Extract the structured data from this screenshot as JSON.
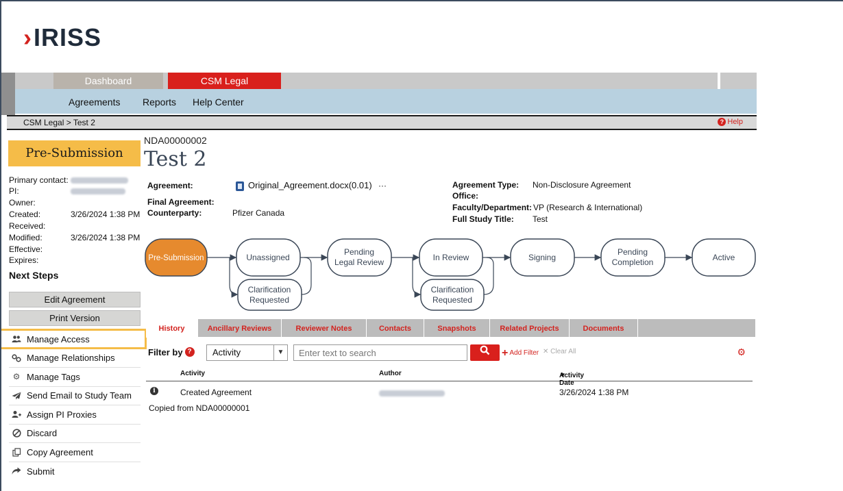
{
  "logo": {
    "chevron": "›",
    "text": "IRISS"
  },
  "top_nav": {
    "tabs": [
      {
        "label": "Dashboard",
        "active": false
      },
      {
        "label": "CSM Legal",
        "active": true
      }
    ]
  },
  "sub_nav": {
    "items": [
      "Agreements",
      "Reports",
      "Help Center"
    ]
  },
  "breadcrumb": {
    "root": "CSM Legal",
    "separator": ">",
    "current": "Test 2",
    "help_label": "Help"
  },
  "status": {
    "label": "Pre-Submission"
  },
  "details": {
    "primary_contact_label": "Primary contact:",
    "pi_label": "PI:",
    "owner_label": "Owner:",
    "created_label": "Created:",
    "created_value": "3/26/2024 1:38 PM",
    "received_label": "Received:",
    "modified_label": "Modified:",
    "modified_value": "3/26/2024 1:38 PM",
    "effective_label": "Effective:",
    "expires_label": "Expires:"
  },
  "next_steps": {
    "heading": "Next Steps",
    "edit_label": "Edit Agreement",
    "print_label": "Print Version",
    "actions": [
      {
        "label": "Manage Access",
        "icon": "users-icon"
      },
      {
        "label": "Manage Relationships",
        "icon": "link-icon"
      },
      {
        "label": "Manage Tags",
        "icon": "gear-icon"
      },
      {
        "label": "Send Email to Study Team",
        "icon": "paper-plane-icon"
      },
      {
        "label": "Assign PI Proxies",
        "icon": "user-plus-icon"
      },
      {
        "label": "Discard",
        "icon": "ban-icon"
      },
      {
        "label": "Copy Agreement",
        "icon": "copy-icon"
      },
      {
        "label": "Submit",
        "icon": "share-arrow-icon"
      }
    ]
  },
  "record": {
    "id": "NDA00000002",
    "title": "Test 2",
    "agreement_label": "Agreement:",
    "agreement_file": "Original_Agreement.docx(0.01)",
    "more": "···",
    "final_agreement_label": "Final Agreement:",
    "counterparty_label": "Counterparty:",
    "counterparty_value": "Pfizer Canada",
    "agreement_type_label": "Agreement Type:",
    "agreement_type_value": "Non-Disclosure Agreement",
    "office_label": "Office:",
    "faculty_label": "Faculty/Department:",
    "faculty_value": "VP (Research & International)",
    "full_title_label": "Full Study Title:",
    "full_title_value": "Test"
  },
  "workflow": {
    "states": [
      {
        "label": "Pre-Submission",
        "current": true
      },
      {
        "label": "Unassigned"
      },
      {
        "label": "Pending Legal Review"
      },
      {
        "label": "In Review"
      },
      {
        "label": "Signing"
      },
      {
        "label": "Pending Completion"
      },
      {
        "label": "Active"
      }
    ],
    "clarification_label": "Clarification Requested",
    "colors": {
      "current": "#e68a2e",
      "border": "#3a4656"
    }
  },
  "tabs": {
    "items": [
      "History",
      "Ancillary Reviews",
      "Reviewer Notes",
      "Contacts",
      "Snapshots",
      "Related Projects",
      "Documents"
    ],
    "active": "History"
  },
  "filter": {
    "label": "Filter by",
    "select_value": "Activity",
    "search_placeholder": "Enter text to search",
    "add_filter": "Add Filter",
    "clear_all": "Clear All"
  },
  "history_table": {
    "columns": [
      "Activity",
      "Author",
      "Activity Date"
    ],
    "sort_indicator": "▼",
    "rows": [
      {
        "activity": "Created Agreement",
        "date": "3/26/2024 1:38 PM",
        "note": "Copied from NDA00000001"
      }
    ]
  },
  "colors": {
    "accent_red": "#d9201c",
    "status_yellow": "#f5bc48",
    "subnav_blue": "#b8d1e0"
  }
}
